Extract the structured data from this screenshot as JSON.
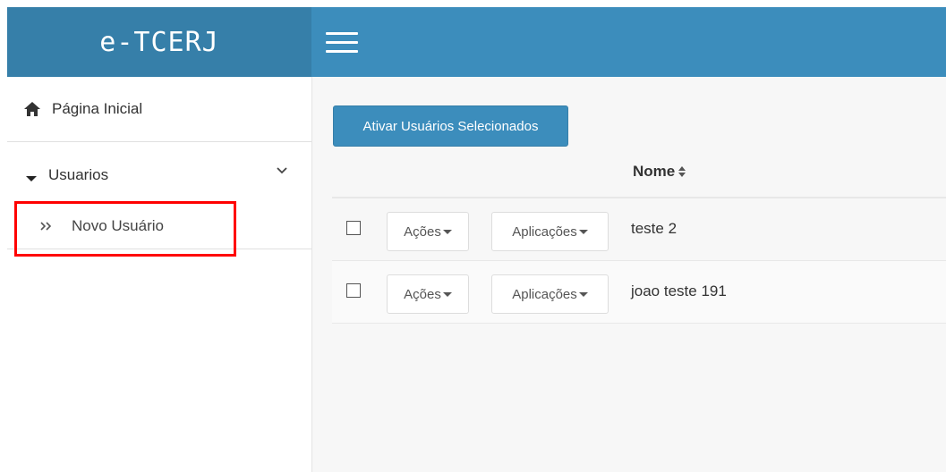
{
  "app": {
    "title": "e-TCERJ"
  },
  "sidebar": {
    "items": [
      {
        "label": "Página Inicial",
        "icon": "home-icon"
      },
      {
        "label": "Usuarios",
        "icon": "caret-down-icon",
        "expanded": true,
        "children": [
          {
            "label": "Novo Usuário",
            "icon": "double-chevron-right-icon"
          }
        ]
      }
    ]
  },
  "main": {
    "activate_button": "Ativar Usuários Selecionados",
    "table": {
      "headers": {
        "nome": "Nome"
      },
      "rows": [
        {
          "checked": false,
          "actions_label": "Ações",
          "apps_label": "Aplicações",
          "nome": "teste 2"
        },
        {
          "checked": false,
          "actions_label": "Ações",
          "apps_label": "Aplicações",
          "nome": "joao teste 191"
        }
      ]
    }
  },
  "colors": {
    "brand": "#367fa9",
    "navbar": "#3c8dbc",
    "highlight": "#ff0000"
  }
}
